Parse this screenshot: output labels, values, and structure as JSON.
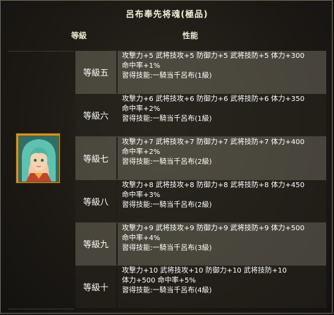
{
  "title": "呂布奉先将魂(極品)",
  "headers": {
    "level": "等級",
    "stats": "性能"
  },
  "portrait_icon": "character-portrait",
  "rows": [
    {
      "level": "等級五",
      "lines": [
        "攻撃力+5  武将技攻+5  防御力+5  武将技防+5  体力+300",
        "命中率+1%",
        "習得技能:一騎当千呂布(1級)"
      ]
    },
    {
      "level": "等級六",
      "lines": [
        "攻撃力+6  武将技攻+6  防御力+6  武将技防+6  体力+350",
        "命中率+2%",
        "習得技能:一騎当千呂布(1級)"
      ]
    },
    {
      "level": "等級七",
      "lines": [
        "攻撃力+7  武将技攻+7  防御力+7  武将技防+7  体力+400",
        "命中率+2%",
        "習得技能:一騎当千呂布(2級)"
      ]
    },
    {
      "level": "等級八",
      "lines": [
        "攻撃力+8  武将技攻+8  防御力+8  武将技防+8  体力+450",
        "命中率+3%",
        "習得技能:一騎当千呂布(2級)"
      ]
    },
    {
      "level": "等級九",
      "lines": [
        "攻撃力+9  武将技攻+9  防御力+9  武将技防+9  体力+500",
        "命中率+4%",
        "習得技能:一騎当千呂布(3級)"
      ]
    },
    {
      "level": "等級十",
      "lines": [
        "攻撃力+10  武将技攻+10  防御力+10  武将技防+10",
        "体力+500  命中率+5%",
        "習得技能:一騎当千呂布(4級)"
      ]
    }
  ]
}
